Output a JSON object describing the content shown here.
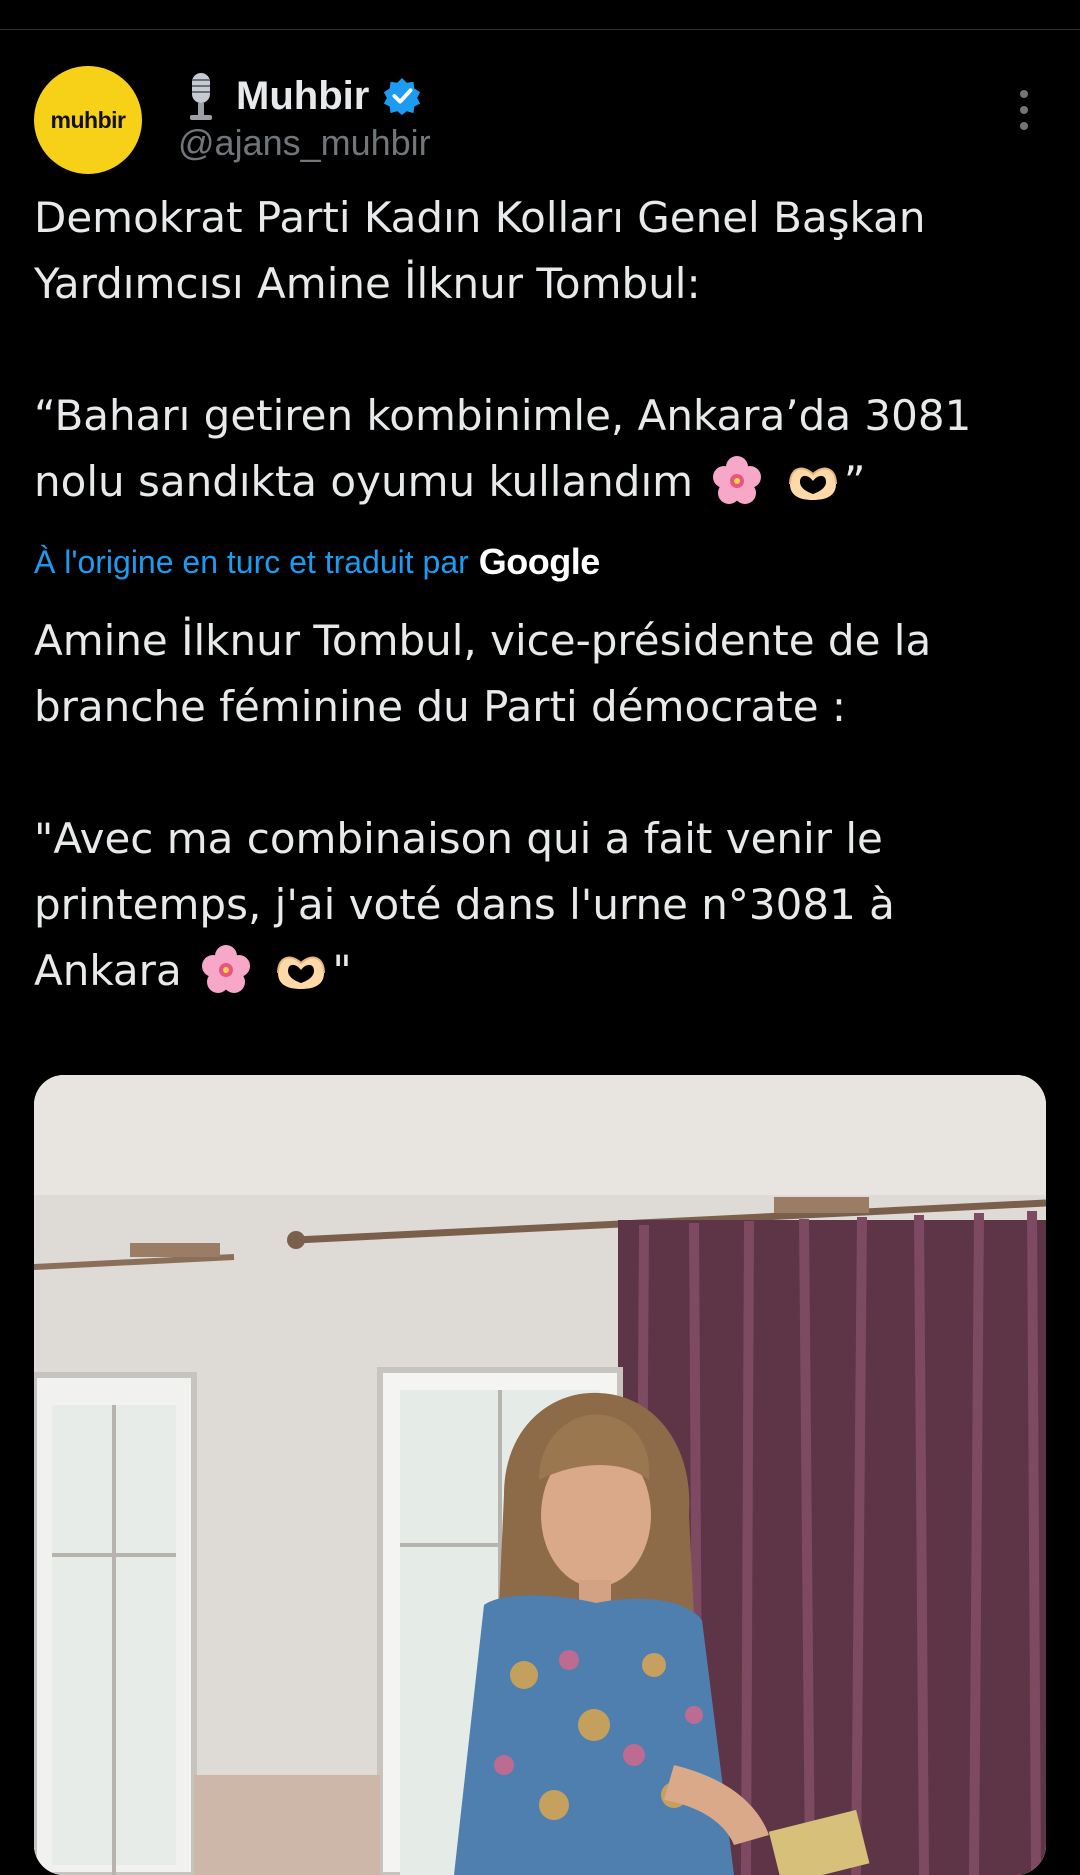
{
  "author": {
    "avatar_text": "muhbir",
    "avatar_color": "#f7d117",
    "display_name": "Muhbir",
    "handle": "@ajans_muhbir",
    "icons": [
      "microphone-icon",
      "verified-badge-icon",
      "more-options-icon"
    ]
  },
  "tweet": {
    "original_line1": "Demokrat Parti Kadın Kolları Genel Başkan Yardımcısı Amine İlknur Tombul:",
    "original_line2_before": "“Baharı getiren kombinimle, Ankara’da 3081 nolu sandıkta oyumu kullandım",
    "original_line2_after": "”",
    "translated_label": "À l'origine en turc et traduit par",
    "translation_provider": "Google",
    "translation_line1": "Amine İlknur Tombul, vice-présidente de la branche féminine du Parti démocrate :",
    "translation_line2_before": "\"Avec ma combinaison qui a fait venir le printemps, j'ai voté dans l'urne n°3081 à Ankara",
    "translation_line2_after": "\"",
    "emojis": [
      "cherry-blossom",
      "heart-hands"
    ]
  },
  "colors": {
    "background": "#000000",
    "text": "#e7e9ea",
    "secondary": "#71767b",
    "link": "#1d9bf0",
    "verified": "#1d9bf0"
  },
  "media": {
    "type": "photo",
    "subject": "woman-in-floral-dress-at-ballot-box"
  }
}
